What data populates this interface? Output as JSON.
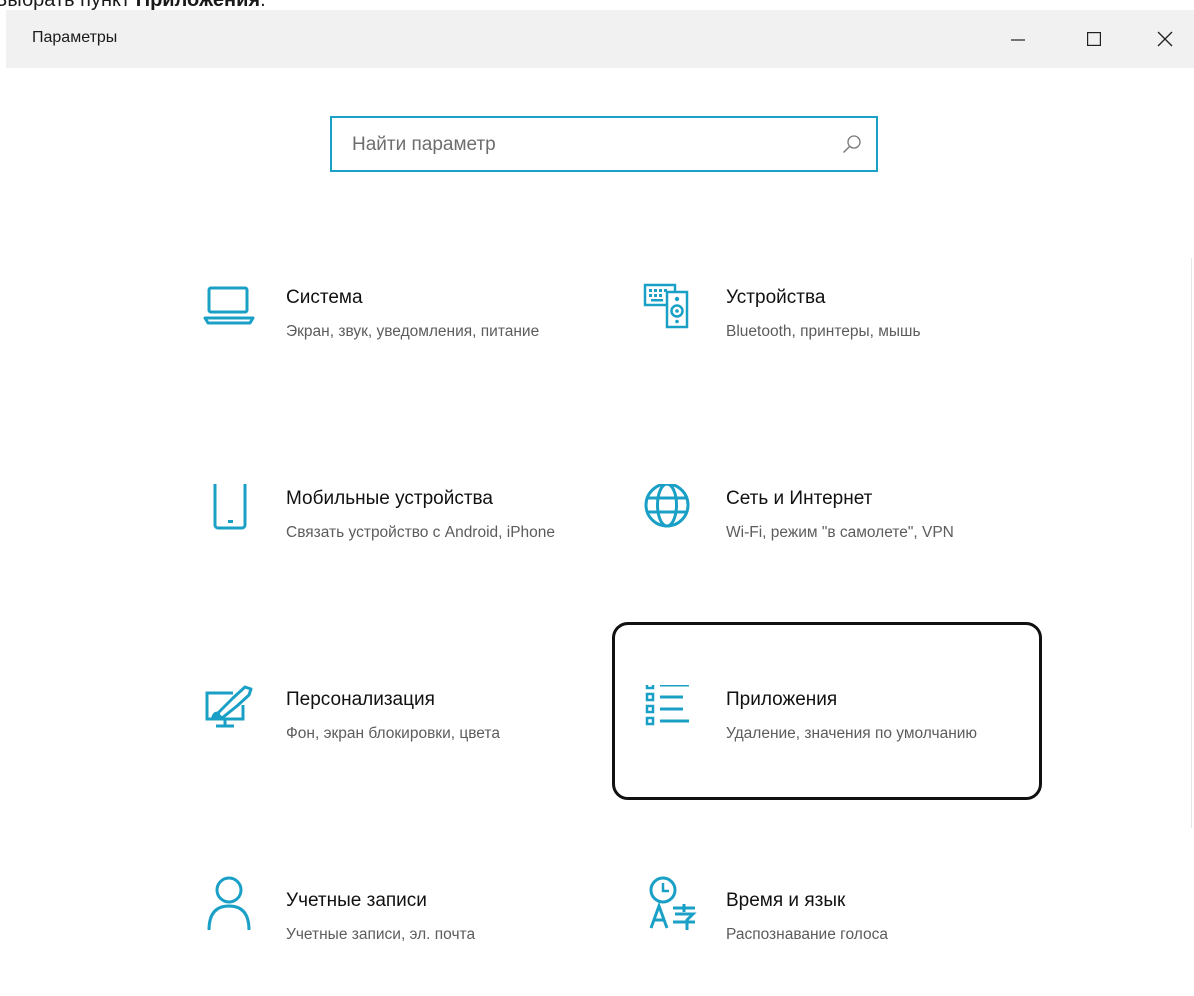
{
  "caption": {
    "prefix": "Выбрать пункт ",
    "bold": "Приложения",
    "suffix": "."
  },
  "window": {
    "title": "Параметры"
  },
  "search": {
    "placeholder": "Найти параметр"
  },
  "tiles": [
    {
      "title": "Система",
      "subtitle": "Экран, звук, уведомления, питание",
      "icon": "laptop-icon"
    },
    {
      "title": "Устройства",
      "subtitle": "Bluetooth, принтеры, мышь",
      "icon": "devices-icon"
    },
    {
      "title": "Мобильные устройства",
      "subtitle": "Связать устройство с Android, iPhone",
      "icon": "phone-icon"
    },
    {
      "title": "Сеть и Интернет",
      "subtitle": "Wi-Fi, режим \"в самолете\", VPN",
      "icon": "globe-icon"
    },
    {
      "title": "Персонализация",
      "subtitle": "Фон, экран блокировки, цвета",
      "icon": "personalization-icon"
    },
    {
      "title": "Приложения",
      "subtitle": "Удаление, значения по умолчанию",
      "icon": "apps-list-icon"
    },
    {
      "title": "Учетные записи",
      "subtitle": "Учетные записи, эл. почта",
      "icon": "person-icon"
    },
    {
      "title": "Время и язык",
      "subtitle": "Распознавание голоса",
      "icon": "time-language-icon"
    }
  ],
  "colors": {
    "accent": "#1aa0c6",
    "titlebar": "#f1f1f1",
    "highlight_border": "#111111"
  }
}
